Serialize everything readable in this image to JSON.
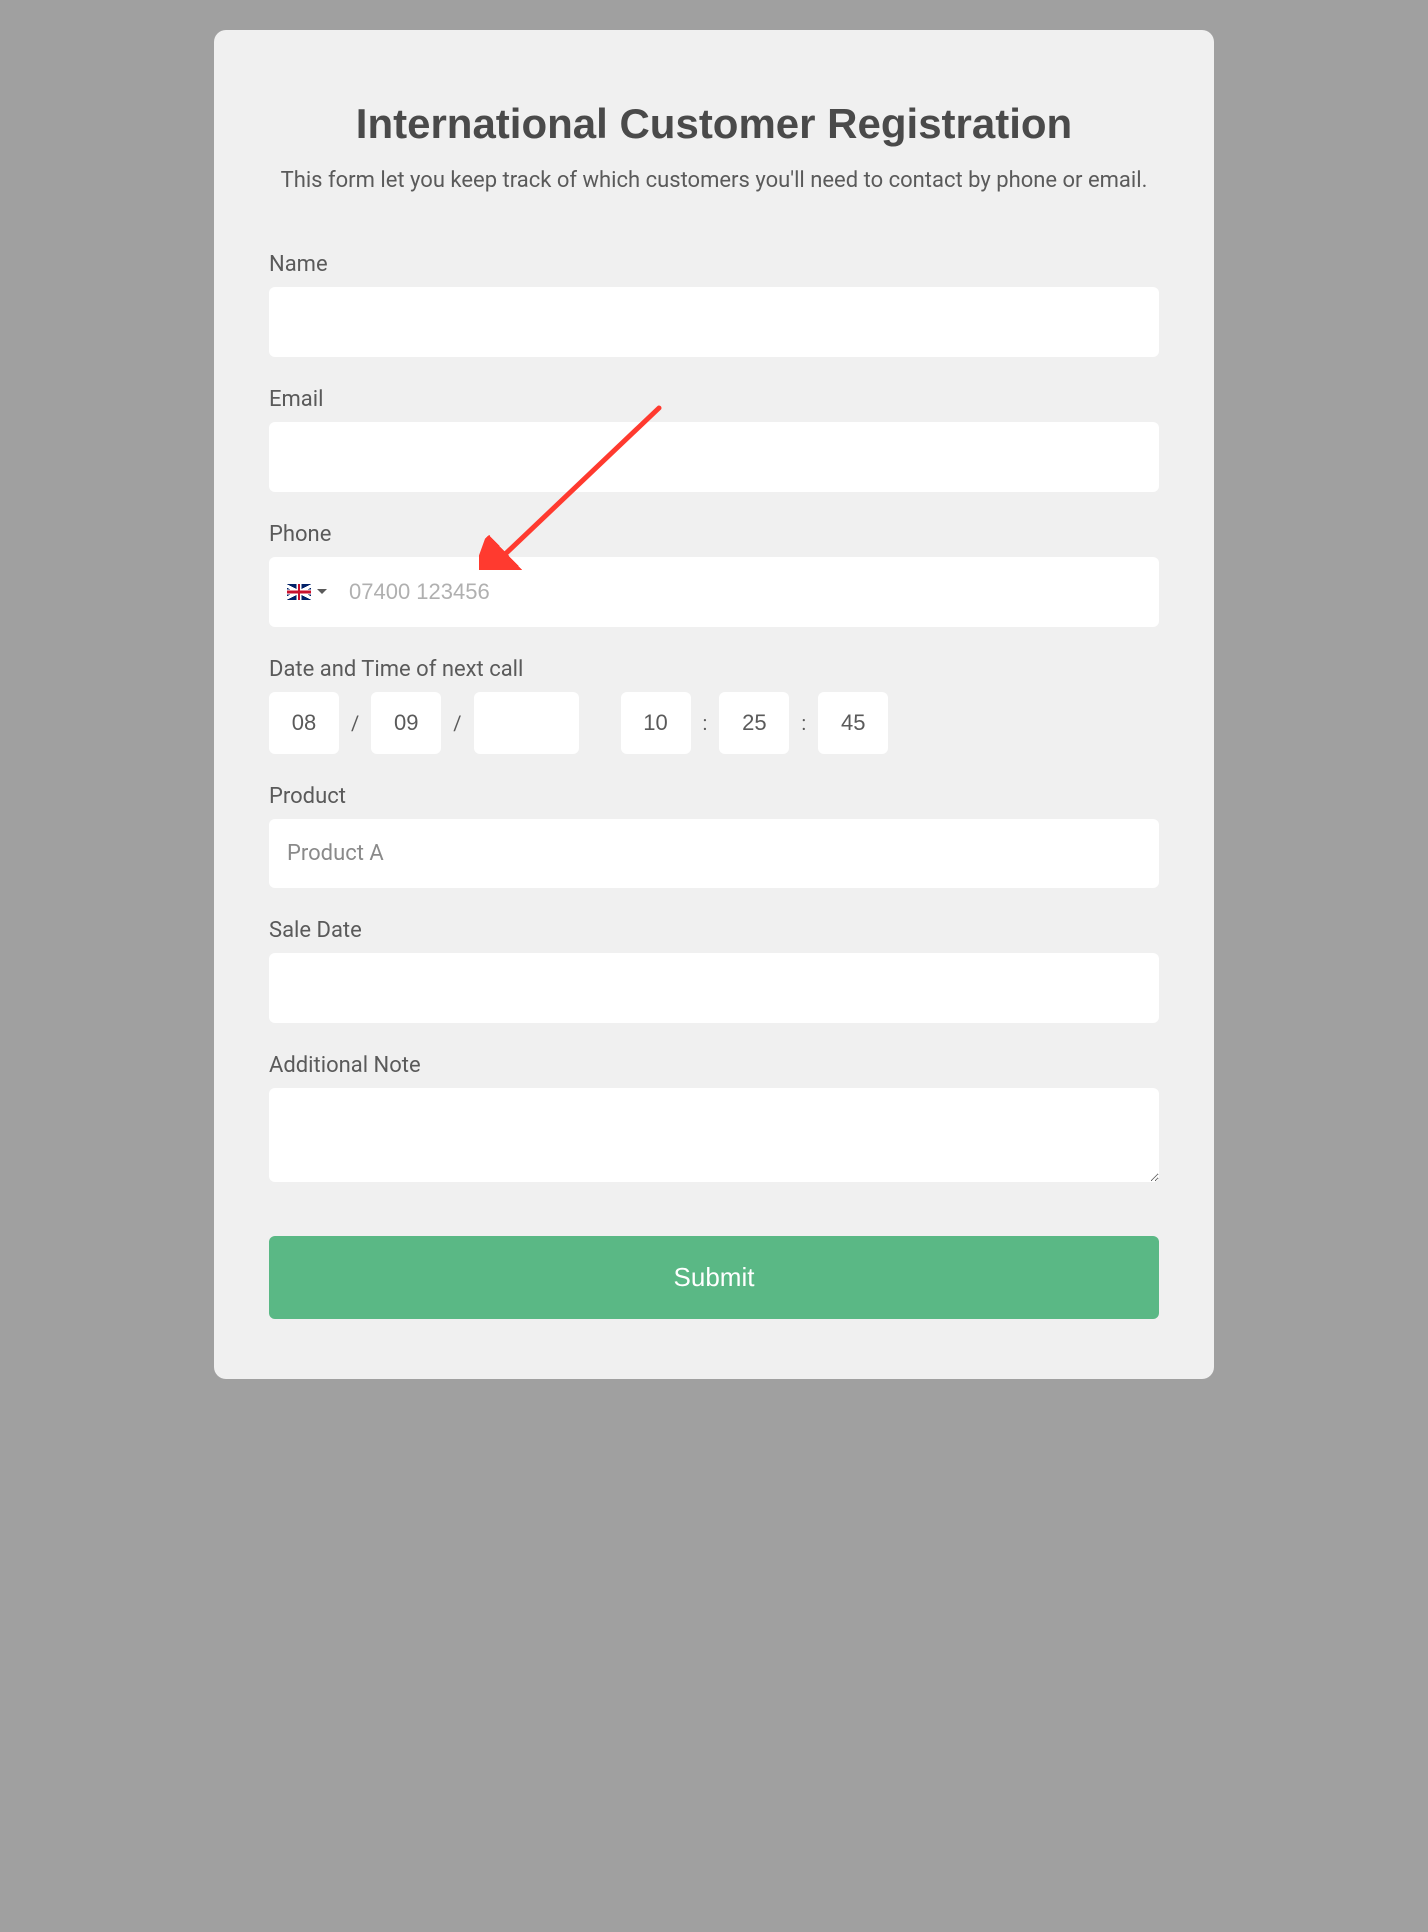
{
  "header": {
    "title": "International Customer Registration",
    "subtitle": "This form let you keep track of which customers you'll need to contact by phone or email."
  },
  "fields": {
    "name_label": "Name",
    "name_value": "",
    "email_label": "Email",
    "email_value": "",
    "phone_label": "Phone",
    "phone_country": "GB",
    "phone_placeholder": "07400 123456",
    "phone_value": "",
    "datetime_label": "Date and Time of next call",
    "date_day": "08",
    "date_month": "09",
    "date_year": "",
    "time_hour": "10",
    "time_minute": "25",
    "time_second": "45",
    "product_label": "Product",
    "product_selected": "Product A",
    "saledate_label": "Sale Date",
    "saledate_value": "",
    "note_label": "Additional Note",
    "note_value": ""
  },
  "actions": {
    "submit_label": "Submit"
  },
  "annotation": {
    "arrow_color": "#ff3a2f"
  }
}
